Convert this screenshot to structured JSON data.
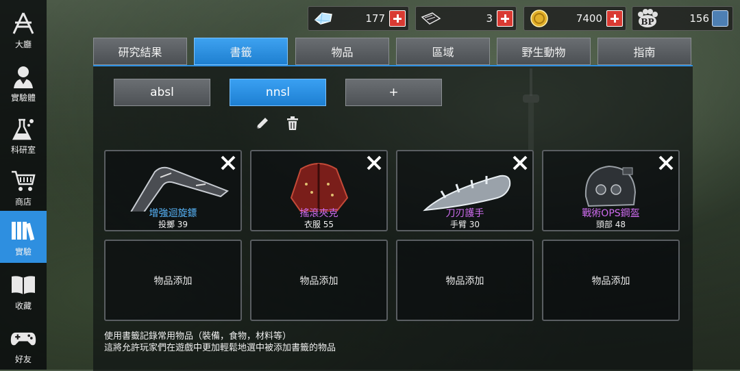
{
  "sidebar": {
    "items": [
      {
        "label": "大廳",
        "icon": "lobby-logo-icon"
      },
      {
        "label": "實驗體",
        "icon": "character-icon"
      },
      {
        "label": "科研室",
        "icon": "flask-icon"
      },
      {
        "label": "商店",
        "icon": "cart-icon"
      },
      {
        "label": "實驗",
        "icon": "books-icon",
        "active": true
      },
      {
        "label": "收藏",
        "icon": "open-book-icon"
      },
      {
        "label": "好友",
        "icon": "gamepad-icon"
      }
    ]
  },
  "resources": {
    "gems": "177",
    "tickets": "3",
    "coins": "7400",
    "bp": "156",
    "bp_label": "BP"
  },
  "tabs": [
    "研究結果",
    "書籤",
    "物品",
    "區域",
    "野生動物",
    "指南"
  ],
  "active_tab": "書籤",
  "bookmarks": {
    "items": [
      "absl",
      "nnsl",
      "+"
    ],
    "active": "nnsl"
  },
  "slots": [
    {
      "name": "增強迴旋鏢",
      "sub": "投擲 39",
      "color": "#59b8ff",
      "icon": "boomerang-icon"
    },
    {
      "name": "搖滾夾克",
      "sub": "衣服 55",
      "color": "#cf6cf0",
      "icon": "jacket-icon"
    },
    {
      "name": "刀刃護手",
      "sub": "手臂 30",
      "color": "#cf6cf0",
      "icon": "blade-gauntlet-icon"
    },
    {
      "name": "戰術OPS鋼盔",
      "sub": "頭部 48",
      "color": "#cf6cf0",
      "icon": "helmet-icon"
    }
  ],
  "empty_slot_label": "物品添加",
  "footer": {
    "line1": "使用書籤記錄常用物品（裝備，食物，材料等）",
    "line2": "這將允許玩家們在遊戲中更加輕鬆地選中被添加書籤的物品"
  },
  "colors": {
    "accent": "#2e8fe0",
    "rare": "#59b8ff",
    "epic": "#cf6cf0",
    "plus": "#d93a32"
  }
}
